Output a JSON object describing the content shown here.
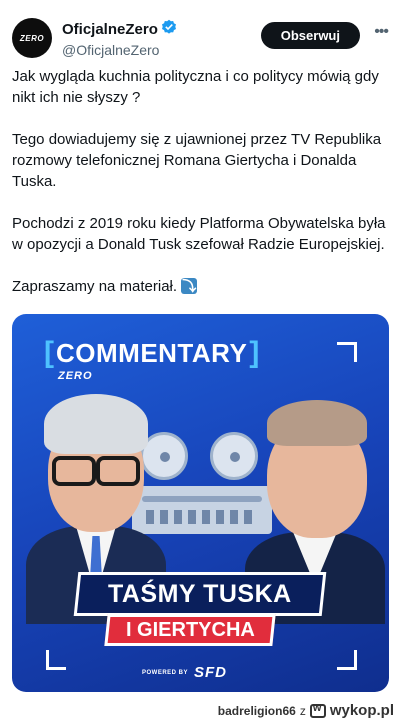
{
  "account": {
    "avatar_text": "ZERO",
    "display_name": "OficjalneZero",
    "handle": "@OficjalneZero"
  },
  "actions": {
    "follow_label": "Obserwuj"
  },
  "tweet": {
    "paragraphs": [
      "Jak wygląda kuchnia polityczna i co politycy mówią gdy nikt ich nie słyszy ?",
      "Tego dowiadujemy się z ujawnionej przez TV Republika rozmowy telefonicznej Romana Giertycha i Donalda Tuska.",
      "Pochodzi z 2019 roku kiedy Platforma Obywatelska była w opozycji a Donald Tusk szefował Radzie Europejskiej.",
      "Zapraszamy na materiał."
    ],
    "emoji": "arrow-right-down"
  },
  "media": {
    "brand_title": "COMMENTARY",
    "brand_sub": "ZERO",
    "headline_line1": "TAŚMY TUSKA",
    "headline_line2": "I GIERTYCHA",
    "powered_label": "POWERED BY",
    "powered_brand": "SFD",
    "colors": {
      "background": "#1f5fd8",
      "accent_blue": "#4ec2ff",
      "banner_navy": "#0a1f5c",
      "banner_red": "#e12d3c"
    }
  },
  "footer": {
    "username": "badreligion66",
    "separator": "z",
    "site": "wykop.pl"
  }
}
